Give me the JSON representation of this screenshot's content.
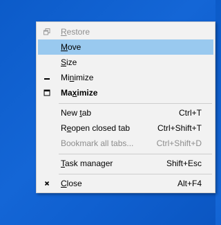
{
  "menu": {
    "items": [
      {
        "label": "Restore",
        "mnemonic_index": 0,
        "shortcut": "",
        "icon": "restore-icon",
        "disabled": true,
        "highlighted": false,
        "bold": false
      },
      {
        "label": "Move",
        "mnemonic_index": 0,
        "shortcut": "",
        "icon": "",
        "disabled": false,
        "highlighted": true,
        "bold": false
      },
      {
        "label": "Size",
        "mnemonic_index": 0,
        "shortcut": "",
        "icon": "",
        "disabled": false,
        "highlighted": false,
        "bold": false
      },
      {
        "label": "Minimize",
        "mnemonic_index": 2,
        "shortcut": "",
        "icon": "minimize-icon",
        "disabled": false,
        "highlighted": false,
        "bold": false
      },
      {
        "label": "Maximize",
        "mnemonic_index": 2,
        "shortcut": "",
        "icon": "maximize-icon",
        "disabled": false,
        "highlighted": false,
        "bold": true
      },
      {
        "label": "New tab",
        "mnemonic_index": 4,
        "shortcut": "Ctrl+T",
        "icon": "",
        "disabled": false,
        "highlighted": false,
        "bold": false
      },
      {
        "label": "Reopen closed tab",
        "mnemonic_index": 1,
        "shortcut": "Ctrl+Shift+T",
        "icon": "",
        "disabled": false,
        "highlighted": false,
        "bold": false
      },
      {
        "label": "Bookmark all tabs...",
        "mnemonic_index": -1,
        "shortcut": "Ctrl+Shift+D",
        "icon": "",
        "disabled": true,
        "highlighted": false,
        "bold": false
      },
      {
        "label": "Task manager",
        "mnemonic_index": 0,
        "shortcut": "Shift+Esc",
        "icon": "",
        "disabled": false,
        "highlighted": false,
        "bold": false
      },
      {
        "label": "Close",
        "mnemonic_index": 0,
        "shortcut": "Alt+F4",
        "icon": "close-icon",
        "disabled": false,
        "highlighted": false,
        "bold": false
      }
    ]
  },
  "colors": {
    "desktop": "#0f5fcf",
    "menu_background": "#f2f2f2",
    "highlight": "#99c9ef",
    "disabled_text": "#8d8d8d"
  }
}
